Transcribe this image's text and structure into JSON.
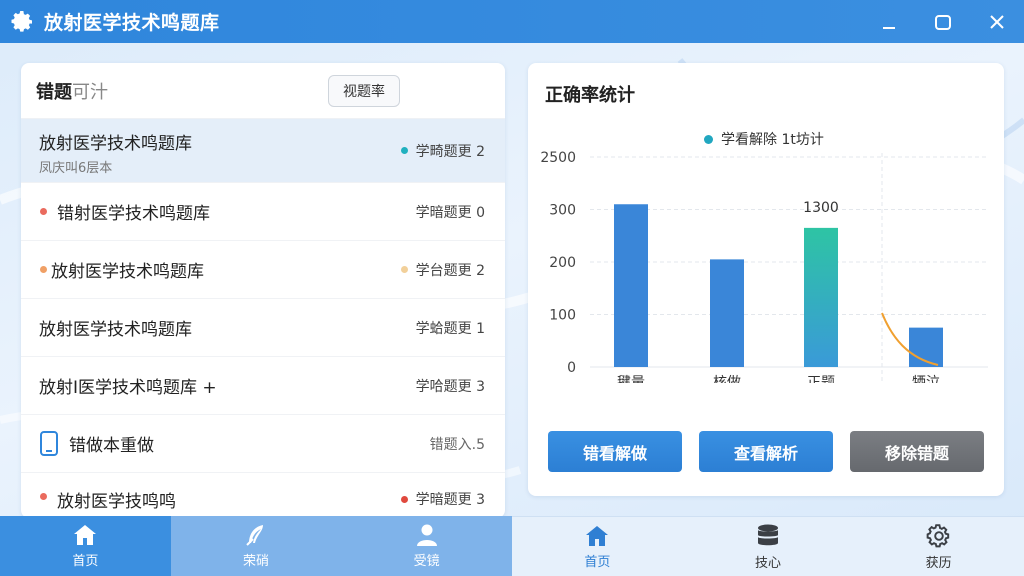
{
  "window": {
    "title": "放射医学技术鸣题库",
    "app_icon": "gear-icon",
    "controls": [
      "minimize-icon",
      "maximize-icon",
      "close-icon"
    ]
  },
  "left_panel": {
    "title_main": "错题",
    "title_muted": "可汁",
    "sort_button": "视题率",
    "items": [
      {
        "title": "放射医学技术鸣题库",
        "subtitle": "凤庆叫6层本",
        "right": "学畸题更 2",
        "dot": "#1fb0bf",
        "right_dot": "#1fb0bf"
      },
      {
        "title": "错射医学技术鸣题库",
        "right": "学暗题更 0",
        "dot": "#ea6b5e"
      },
      {
        "title": "放射医学技术鸣题库",
        "right": "学台题更 2",
        "dot": "#f0a066",
        "right_dot": "#f2d09a"
      },
      {
        "title": "放射医学技术鸣题库",
        "right": "学蛤题更 1"
      },
      {
        "title": "放射I医学技术鸣题库 +",
        "right": "学哈题更 3"
      },
      {
        "title": "错做本重做",
        "right": "错题入.5",
        "icon": "phone-icon"
      },
      {
        "title": "放射医学技鸣鸣",
        "right": "学暗题更 3",
        "dot": "#ea6b5e",
        "right_dot": "#e0493e"
      }
    ]
  },
  "right_panel": {
    "title": "正确率统计",
    "legend": "学看解除 1t坊计",
    "buttons": {
      "view_wrong": "错看解做",
      "view_analysis": "查看解析",
      "remove_wrong": "移除错题"
    }
  },
  "chart_data": {
    "type": "bar",
    "categories": [
      "毽量",
      "核做",
      "正题",
      "牺泣"
    ],
    "values": [
      310,
      205,
      265,
      75
    ],
    "y_tick_labels": [
      "0",
      "100",
      "200",
      "300",
      "2500"
    ],
    "data_labels": [
      "",
      "",
      "1300",
      ""
    ],
    "bar_colors": [
      "#3a86d8",
      "#3a86d8",
      "#3cc0b0",
      "#3a86d8"
    ],
    "legend": "学看解除 1t坊计",
    "grid": true
  },
  "bottom_left_tabs": [
    {
      "label": "首页",
      "icon": "home-icon"
    },
    {
      "label": "荣硝",
      "icon": "feather-icon"
    },
    {
      "label": "受镜",
      "icon": "user-icon"
    }
  ],
  "bottom_right_tabs": [
    {
      "label": "首页",
      "icon": "home-icon"
    },
    {
      "label": "技心",
      "icon": "database-icon"
    },
    {
      "label": "获历",
      "icon": "gear-icon"
    }
  ]
}
